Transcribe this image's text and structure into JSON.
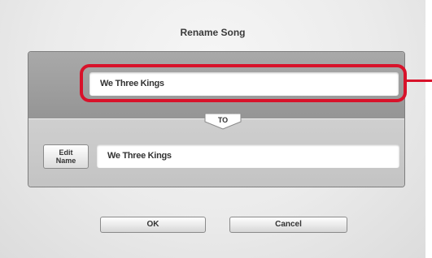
{
  "dialog": {
    "title": "Rename Song"
  },
  "rename": {
    "current_name": "We Three Kings",
    "to_label": "TO",
    "new_name": "We Three Kings",
    "edit_name_line1": "Edit",
    "edit_name_line2": "Name"
  },
  "buttons": {
    "ok_label": "OK",
    "cancel_label": "Cancel"
  },
  "colors": {
    "highlight": "#d8122a",
    "panel_dark": "#a0a0a0",
    "panel_light": "#c9c9c9"
  }
}
